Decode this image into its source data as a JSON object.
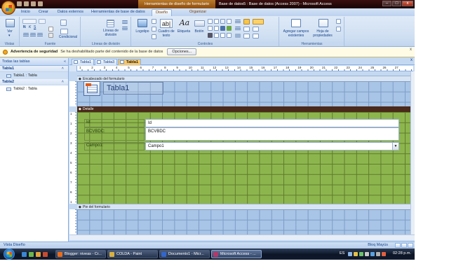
{
  "window": {
    "context_tool_label": "Herramientas de diseño de formulario",
    "title": "Base de datos5 : Base de datos (Access 2007) - Microsoft Access",
    "controls": [
      "–",
      "□",
      "x"
    ]
  },
  "ribbon_tabs": [
    {
      "label": "Inicio"
    },
    {
      "label": "Crear"
    },
    {
      "label": "Datos externos"
    },
    {
      "label": "Herramientas de base de datos"
    },
    {
      "label": "Diseño",
      "active": true
    },
    {
      "label": "Organizar"
    }
  ],
  "ribbon": {
    "groups": {
      "vistas": "Vistas",
      "fuente": "Fuente",
      "lineas": "Líneas de división",
      "controles": "Controles",
      "herramientas": "Herramientas"
    },
    "buttons": {
      "ver": "Ver",
      "condicional": "Condicional",
      "lineas_division": "Líneas de división",
      "logotipo": "Logotipo",
      "cuadro_texto": "Cuadro de texto",
      "etiqueta": "Etiqueta",
      "boton": "Botón",
      "agregar_campos": "Agregar campos existentes",
      "hoja_propiedades": "Hoja de propiedades"
    }
  },
  "message_bar": {
    "title": "Advertencia de seguridad",
    "text": "Se ha deshabilitado parte del contenido de la base de datos",
    "button": "Opciones..."
  },
  "nav_pane": {
    "header": "Todas las tablas",
    "header_controls": "« ",
    "groups": [
      {
        "name": "Tabla1",
        "items": [
          {
            "label": "Tabla1 : Tabla",
            "selected": true
          }
        ]
      },
      {
        "name": "Tabla2",
        "items": [
          {
            "label": "Tabla2 : Tabla",
            "selected": false
          }
        ]
      }
    ]
  },
  "doc_tabs": [
    {
      "label": "Tabla1",
      "active": false
    },
    {
      "label": "Tabla3",
      "active": false
    },
    {
      "label": "Tabla1",
      "active": true
    }
  ],
  "ruler_numbers": [
    "1",
    "2",
    "3",
    "4",
    "5",
    "6",
    "7",
    "8",
    "9",
    "10",
    "11",
    "12",
    "13",
    "14",
    "15",
    "16",
    "17",
    "18",
    "19",
    "20",
    "21",
    "22",
    "23",
    "24",
    "25",
    "26",
    "27"
  ],
  "vruler_numbers": [
    "1",
    "1",
    "2",
    "3",
    "4",
    "5",
    "6",
    "7",
    "8",
    "1"
  ],
  "form": {
    "header_section": "Encabezado del formulario",
    "detail_section": "Detalle",
    "footer_section": "Pie del formulario",
    "title": "Tabla1",
    "fields": [
      {
        "label": "Id:",
        "value": "Id",
        "combo": false
      },
      {
        "label": "BCVBDC:",
        "value": "BCVBDC",
        "combo": false
      },
      {
        "label": "Campo1:",
        "value": "Campo1",
        "combo": true
      }
    ]
  },
  "status_bar": {
    "left": "Vista Diseño",
    "right": "Bloq Mayús"
  },
  "taskbar": {
    "tasks": [
      {
        "label": "Blogger: niveas - Cr...",
        "active": false
      },
      {
        "label": "COLDA - Paint",
        "active": false
      },
      {
        "label": "Documento1 - Micr...",
        "active": false
      },
      {
        "label": "Microsoft Access - ...",
        "active": true
      }
    ],
    "lang": "ES",
    "clock": "02:28 p.m."
  },
  "colors": {
    "grid_green": "#8db54e",
    "grid_blue": "#a8c4e6",
    "detail_bar": "#4a2a1a",
    "context_tab": "#b97a2a"
  }
}
